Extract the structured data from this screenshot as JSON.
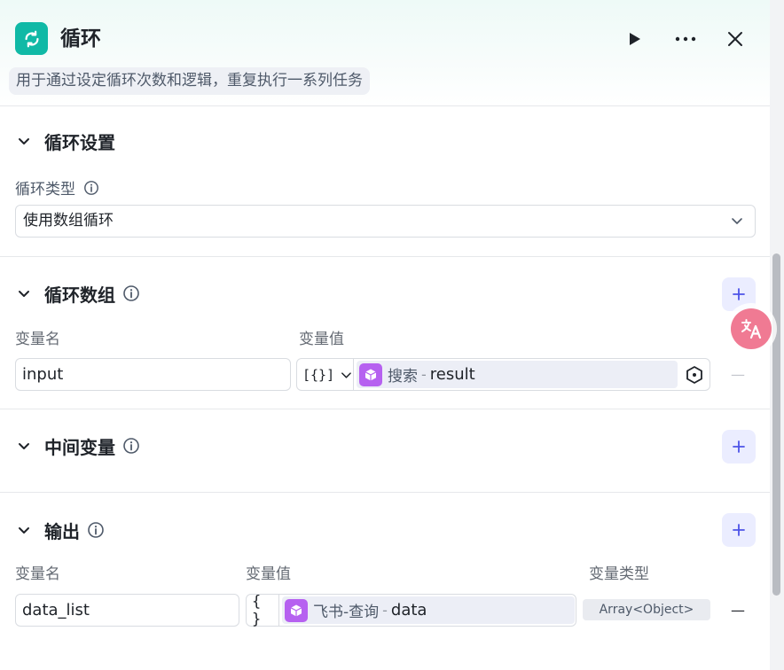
{
  "header": {
    "title": "循环",
    "description": "用于通过设定循环次数和逻辑，重复执行一系列任务"
  },
  "loop_settings": {
    "section_title": "循环设置",
    "type_label": "循环类型",
    "type_value": "使用数组循环"
  },
  "loop_array": {
    "section_title": "循环数组",
    "col_name": "变量名",
    "col_value": "变量值",
    "row": {
      "name": "input",
      "type_glyph": "[{}]",
      "ref_node": "搜索",
      "ref_sep": "-",
      "ref_var": "result",
      "remove_label": "—"
    }
  },
  "intermediate": {
    "section_title": "中间变量"
  },
  "output": {
    "section_title": "输出",
    "col_name": "变量名",
    "col_value": "变量值",
    "col_type": "变量类型",
    "row": {
      "name": "data_list",
      "type_glyph": "{ }",
      "ref_node": "飞书-查询",
      "ref_sep": "-",
      "ref_var": "data",
      "var_type": "Array<Object>",
      "remove_label": "—"
    }
  },
  "colors": {
    "accent": "#10b9a6",
    "ref_icon": "#b661f0",
    "add_button_bg": "#ebedff",
    "add_button_fg": "#4d53e8"
  },
  "icons": {
    "node": "loop-icon",
    "run": "play-icon",
    "more": "more-icon",
    "close": "close-icon",
    "info": "info-icon",
    "collapse": "chevron-down-icon",
    "add": "plus-icon",
    "reference": "cube-icon",
    "variable_picker": "hexagon-icon",
    "translate": "translate-icon"
  }
}
